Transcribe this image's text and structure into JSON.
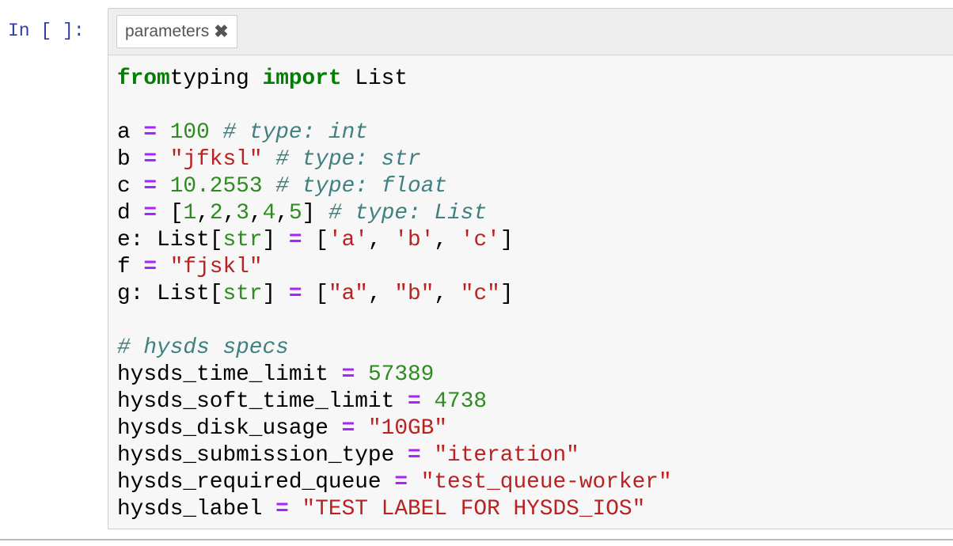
{
  "prompt": "In [ ]:",
  "tag": {
    "label": "parameters",
    "remove_icon": "✖"
  },
  "code_lines": [
    [
      [
        "kw",
        "from"
      ],
      [
        "",
        "typing "
      ],
      [
        "kw",
        "import"
      ],
      [
        "",
        " List"
      ]
    ],
    [],
    [
      [
        "",
        "a "
      ],
      [
        "op",
        "="
      ],
      [
        "",
        " "
      ],
      [
        "num",
        "100"
      ],
      [
        "",
        " "
      ],
      [
        "cm",
        "# type: int"
      ]
    ],
    [
      [
        "",
        "b "
      ],
      [
        "op",
        "="
      ],
      [
        "",
        " "
      ],
      [
        "str",
        "\"jfksl\""
      ],
      [
        "",
        " "
      ],
      [
        "cm",
        "# type: str"
      ]
    ],
    [
      [
        "",
        "c "
      ],
      [
        "op",
        "="
      ],
      [
        "",
        " "
      ],
      [
        "num",
        "10.2553"
      ],
      [
        "",
        " "
      ],
      [
        "cm",
        "# type: float"
      ]
    ],
    [
      [
        "",
        "d "
      ],
      [
        "op",
        "="
      ],
      [
        "",
        " ["
      ],
      [
        "num",
        "1"
      ],
      [
        "",
        ","
      ],
      [
        "num",
        "2"
      ],
      [
        "",
        ","
      ],
      [
        "num",
        "3"
      ],
      [
        "",
        ","
      ],
      [
        "num",
        "4"
      ],
      [
        "",
        ","
      ],
      [
        "num",
        "5"
      ],
      [
        "",
        "] "
      ],
      [
        "cm",
        "# type: List"
      ]
    ],
    [
      [
        "",
        "e: List["
      ],
      [
        "bi",
        "str"
      ],
      [
        "",
        "] "
      ],
      [
        "op",
        "="
      ],
      [
        "",
        " ["
      ],
      [
        "str",
        "'a'"
      ],
      [
        "",
        ", "
      ],
      [
        "str",
        "'b'"
      ],
      [
        "",
        ", "
      ],
      [
        "str",
        "'c'"
      ],
      [
        "",
        "]"
      ]
    ],
    [
      [
        "",
        "f "
      ],
      [
        "op",
        "="
      ],
      [
        "",
        " "
      ],
      [
        "str",
        "\"fjskl\""
      ]
    ],
    [
      [
        "",
        "g: List["
      ],
      [
        "bi",
        "str"
      ],
      [
        "",
        "] "
      ],
      [
        "op",
        "="
      ],
      [
        "",
        " ["
      ],
      [
        "str",
        "\"a\""
      ],
      [
        "",
        ", "
      ],
      [
        "str",
        "\"b\""
      ],
      [
        "",
        ", "
      ],
      [
        "str",
        "\"c\""
      ],
      [
        "",
        "]"
      ]
    ],
    [],
    [
      [
        "cm",
        "# hysds specs"
      ]
    ],
    [
      [
        "",
        "hysds_time_limit "
      ],
      [
        "op",
        "="
      ],
      [
        "",
        " "
      ],
      [
        "num",
        "57389"
      ]
    ],
    [
      [
        "",
        "hysds_soft_time_limit "
      ],
      [
        "op",
        "="
      ],
      [
        "",
        " "
      ],
      [
        "num",
        "4738"
      ]
    ],
    [
      [
        "",
        "hysds_disk_usage "
      ],
      [
        "op",
        "="
      ],
      [
        "",
        " "
      ],
      [
        "str",
        "\"10GB\""
      ]
    ],
    [
      [
        "",
        "hysds_submission_type "
      ],
      [
        "op",
        "="
      ],
      [
        "",
        " "
      ],
      [
        "str",
        "\"iteration\""
      ]
    ],
    [
      [
        "",
        "hysds_required_queue "
      ],
      [
        "op",
        "="
      ],
      [
        "",
        " "
      ],
      [
        "str",
        "\"test_queue-worker\""
      ]
    ],
    [
      [
        "",
        "hysds_label "
      ],
      [
        "op",
        "="
      ],
      [
        "",
        " "
      ],
      [
        "str",
        "\"TEST LABEL FOR HYSDS_IOS\""
      ]
    ]
  ]
}
